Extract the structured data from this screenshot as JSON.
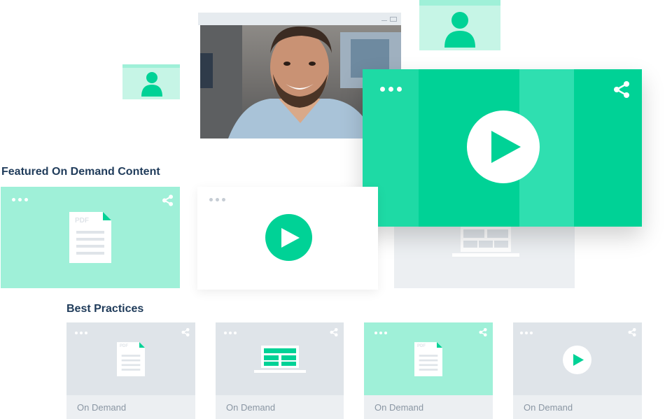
{
  "sections": {
    "featured_title": "Featured On Demand Content",
    "best_practices_title": "Best Practices"
  },
  "featured": {
    "pdf_card": {
      "doc_label": "PDF"
    }
  },
  "best_practice_cards": [
    {
      "kind": "pdf",
      "doc_label": "PDF",
      "label": "On Demand"
    },
    {
      "kind": "laptop",
      "label": "On Demand"
    },
    {
      "kind": "pdf",
      "doc_label": "PDF",
      "label": "On Demand"
    },
    {
      "kind": "video",
      "label": "On Demand"
    }
  ],
  "icons": {
    "menu": "more-dots-icon",
    "share": "share-icon",
    "play": "play-icon",
    "user": "user-icon",
    "pdf": "pdf-document-icon",
    "laptop": "laptop-icon"
  },
  "colors": {
    "accent": "#00d296",
    "accent_light": "#9ff0d8",
    "accent_pale": "#c6f5e6",
    "card_grey": "#dfe4e9",
    "heading": "#1f3b5a"
  }
}
